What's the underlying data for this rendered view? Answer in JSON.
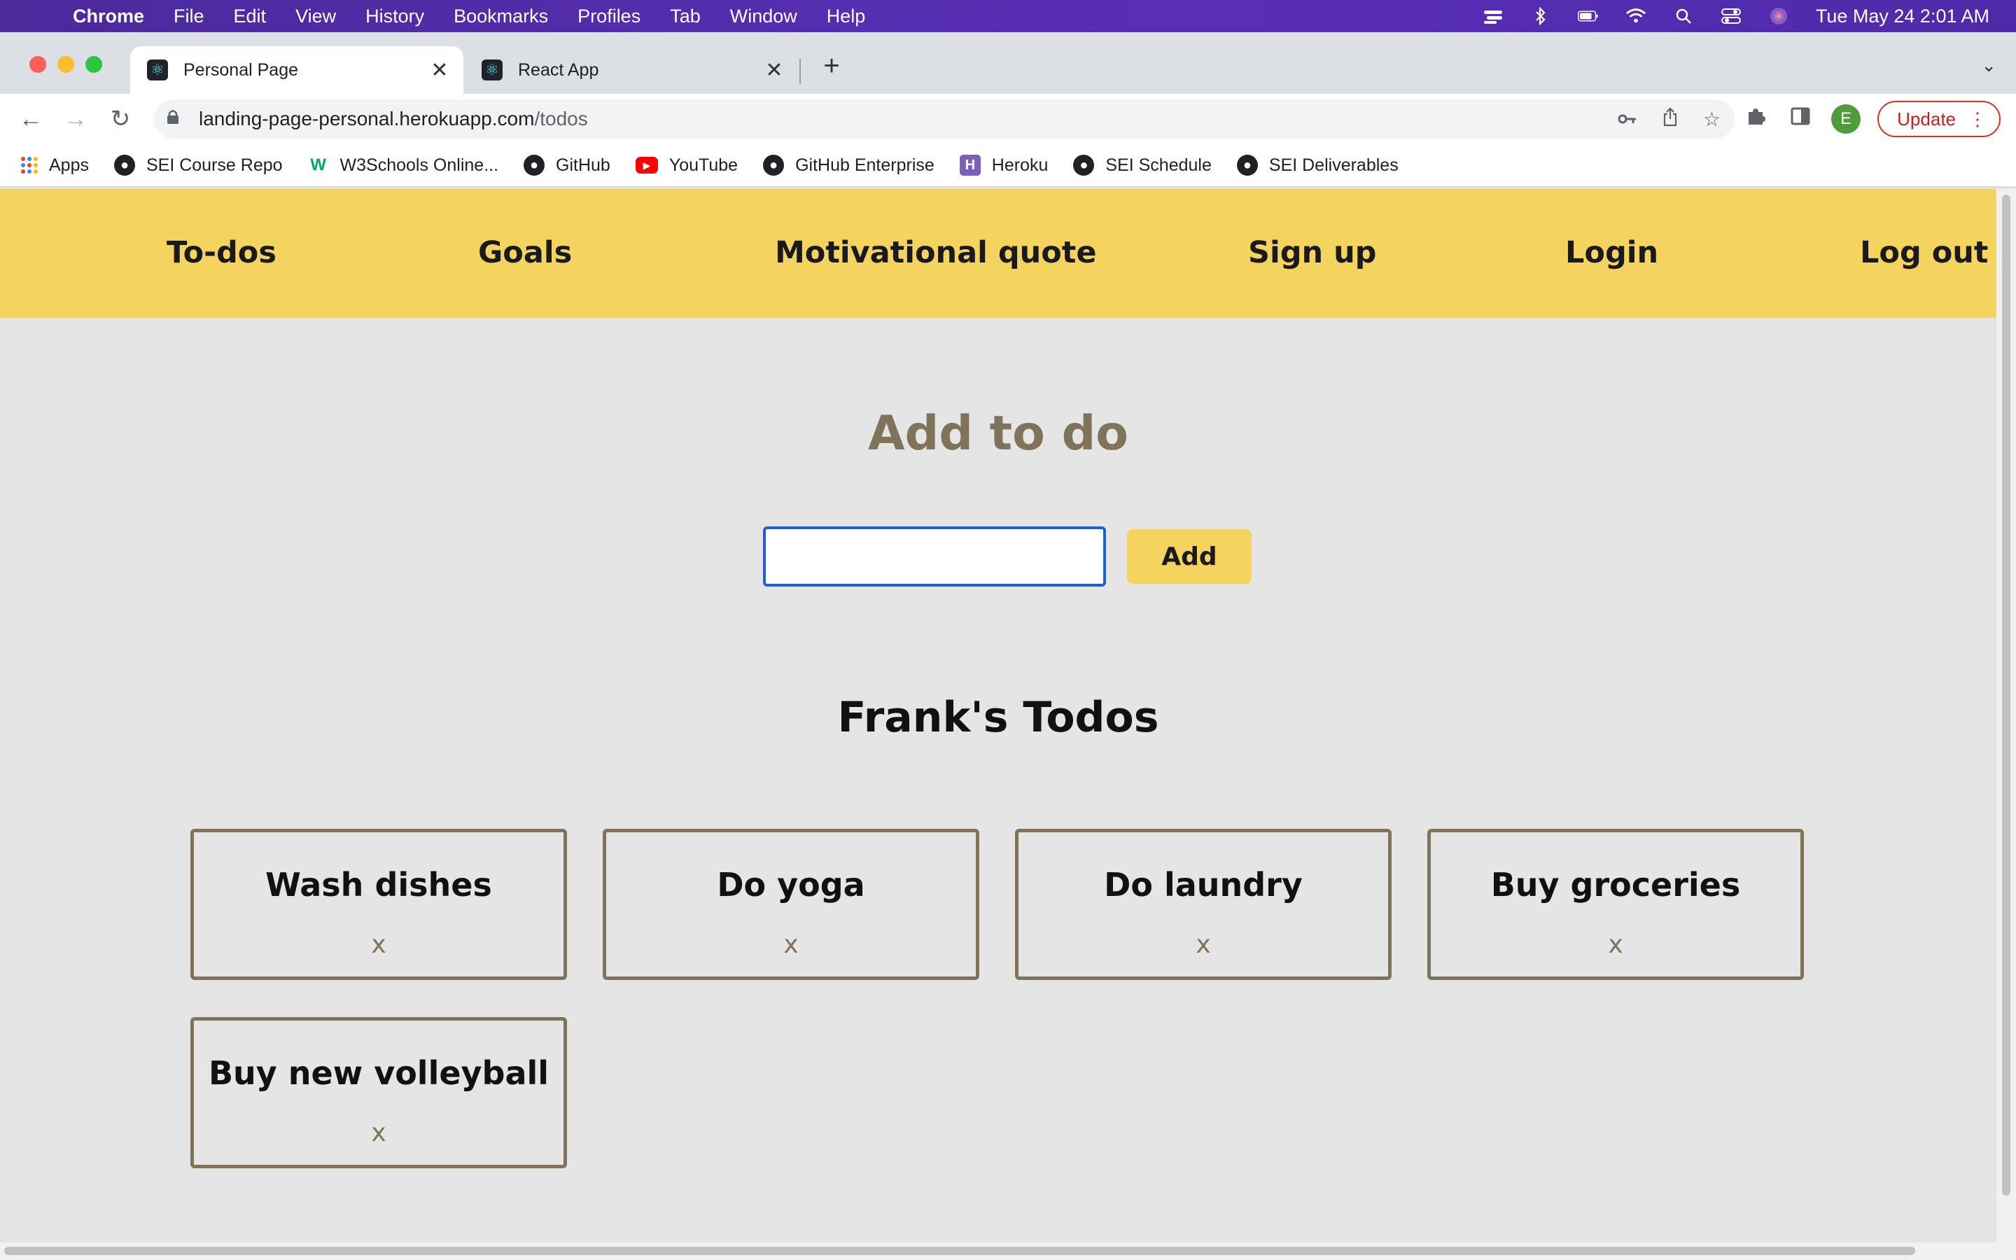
{
  "menubar": {
    "app": "Chrome",
    "items": [
      "File",
      "Edit",
      "View",
      "History",
      "Bookmarks",
      "Profiles",
      "Tab",
      "Window",
      "Help"
    ],
    "clock": "Tue May 24  2:01 AM"
  },
  "tabs": [
    {
      "title": "Personal Page",
      "active": true
    },
    {
      "title": "React App",
      "active": false
    }
  ],
  "address": {
    "host": "landing-page-personal.herokuapp.com",
    "path": "/todos"
  },
  "toolbar": {
    "update_label": "Update",
    "avatar_letter": "E"
  },
  "bookmarks": [
    {
      "label": "Apps",
      "icon": "apps-grid-icon"
    },
    {
      "label": "SEI Course Repo",
      "icon": "github-icon"
    },
    {
      "label": "W3Schools Online...",
      "icon": "w3schools-icon"
    },
    {
      "label": "GitHub",
      "icon": "github-icon"
    },
    {
      "label": "YouTube",
      "icon": "youtube-icon"
    },
    {
      "label": "GitHub Enterprise",
      "icon": "github-icon"
    },
    {
      "label": "Heroku",
      "icon": "heroku-icon"
    },
    {
      "label": "SEI Schedule",
      "icon": "github-icon"
    },
    {
      "label": "SEI Deliverables",
      "icon": "github-icon"
    }
  ],
  "site": {
    "nav": [
      "To-dos",
      "Goals",
      "Motivational quote",
      "Sign up",
      "Login",
      "Log out"
    ],
    "heading": "Add to do",
    "input_value": "",
    "add_label": "Add",
    "list_title": "Frank's Todos",
    "todos": [
      {
        "text": "Wash dishes",
        "remove": "x"
      },
      {
        "text": "Do yoga",
        "remove": "x"
      },
      {
        "text": "Do laundry",
        "remove": "x"
      },
      {
        "text": "Buy groceries",
        "remove": "x"
      },
      {
        "text": "Buy new volleyball",
        "remove": "x"
      }
    ]
  },
  "colors": {
    "nav_bg": "#f4d35e",
    "accent_text": "#7f735a",
    "page_bg": "#e5e5e5",
    "input_focus": "#1f5fcf"
  }
}
